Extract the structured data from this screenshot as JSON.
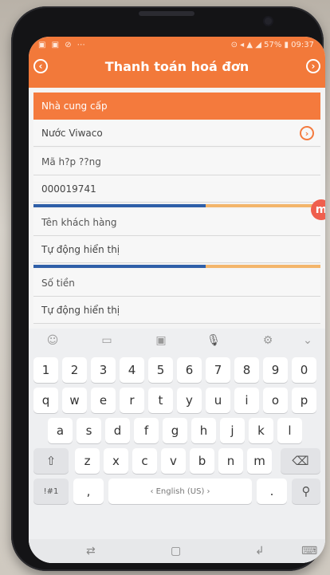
{
  "status_bar": {
    "left_icons": "▣ ▣ ⊘ ⋯",
    "right_text": "⊙ ◂ ▲ ◢ 57% ▮ 09:37"
  },
  "header": {
    "title": "Thanh toán hoá đơn",
    "back_icon": "chevron-left-icon",
    "next_icon": "chevron-right-icon"
  },
  "form": {
    "provider_label": "Nhà cung cấp",
    "provider_value": "Nước Viwaco",
    "contract_label": "Mã h?p ??ng",
    "contract_value": "000019741",
    "customer_label": "Tên khách hàng",
    "customer_value": "Tự động hiển thị",
    "amount_label": "Số tiền",
    "amount_value": "Tự động hiển thị",
    "fab_label": "m"
  },
  "keyboard": {
    "toolbar_icons": [
      "smiley-icon",
      "sticker-icon",
      "clipboard-icon",
      "microphone-icon",
      "settings-icon",
      "collapse-chevron-icon"
    ],
    "row_numbers": [
      "1",
      "2",
      "3",
      "4",
      "5",
      "6",
      "7",
      "8",
      "9",
      "0"
    ],
    "row_q": [
      "q",
      "w",
      "e",
      "r",
      "t",
      "y",
      "u",
      "i",
      "o",
      "p"
    ],
    "row_a": [
      "a",
      "s",
      "d",
      "f",
      "g",
      "h",
      "j",
      "k",
      "l"
    ],
    "row_z": [
      "z",
      "x",
      "c",
      "v",
      "b",
      "n",
      "m"
    ],
    "shift_label": "⇧",
    "backspace_label": "⌫",
    "symbols_label": "!#1",
    "comma_label": ",",
    "space_label": "‹ English (US) ›",
    "period_label": ".",
    "search_label": "⚲"
  },
  "nav_bar": {
    "recent_label": "⇄",
    "home_label": "▢",
    "back_label": "↲",
    "keyboard_label": "⌨"
  }
}
